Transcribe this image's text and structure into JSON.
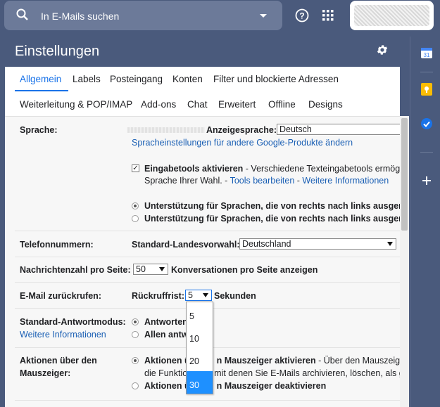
{
  "topbar": {
    "search_placeholder": "In E-Mails suchen",
    "icons": [
      "search-icon",
      "chevron-down-icon",
      "help-icon",
      "apps-grid-icon"
    ]
  },
  "page": {
    "title": "Einstellungen"
  },
  "tabs": {
    "row1": [
      "Allgemein",
      "Labels",
      "Posteingang",
      "Konten",
      "Filter und blockierte Adressen"
    ],
    "row2": [
      "Weiterleitung & POP/IMAP",
      "Add-ons",
      "Chat",
      "Erweitert",
      "Offline",
      "Designs"
    ],
    "active": "Allgemein"
  },
  "settings": {
    "language": {
      "label": "Sprache:",
      "display_label": "Anzeigesprache:",
      "display_value": "Deutsch",
      "other_products_link": "Spracheinstellungen für andere Google-Produkte ändern",
      "input_tools_bold": "Eingabetools aktivieren",
      "input_tools_text": " - Verschiedene Texteingabetools ermög",
      "input_tools_line2": "Sprache Ihrer Wahl. - ",
      "edit_tools_link": "Tools bearbeiten",
      "dash": " - ",
      "more_info_link": "Weitere Informationen",
      "rtl_on": "Unterstützung für Sprachen, die von rechts nach links ausgeric",
      "rtl_off": "Unterstützung für Sprachen, die von rechts nach links ausgeric"
    },
    "phone": {
      "label": "Telefonnummern:",
      "default_label": "Standard-Landesvorwahl:",
      "value": "Deutschland"
    },
    "page_size": {
      "label": "Nachrichtenzahl pro Seite:",
      "value": "50",
      "suffix": "Konversationen pro Seite anzeigen"
    },
    "undo_send": {
      "label": "E-Mail zurückrufen:",
      "period_label": "Rückruffrist:",
      "value": "5",
      "suffix": "Sekunden",
      "options": [
        "5",
        "10",
        "20",
        "30"
      ],
      "highlighted": "30"
    },
    "reply": {
      "label": "Standard-Antwortmodus:",
      "more_info_link": "Weitere Informationen",
      "opt1": "Antworten",
      "opt2": "Allen antw"
    },
    "hover": {
      "label_line1": "Aktionen über den",
      "label_line2": "Mauszeiger:",
      "on_bold_a": "Aktionen ü",
      "on_bold_b": "n Mauszeiger aktivieren",
      "on_text": " - Über den Mauszeig",
      "on_line2_a": "die Funktio",
      "on_line2_b": "mit denen Sie E-Mails archivieren, löschen, als g",
      "off_a": "Aktionen ü",
      "off_b": "n Mauszeiger deaktivieren"
    }
  },
  "colors": {
    "accent": "#1a73e8",
    "header_bg": "#4a5a7c",
    "selected_option": "#1e90ff"
  }
}
